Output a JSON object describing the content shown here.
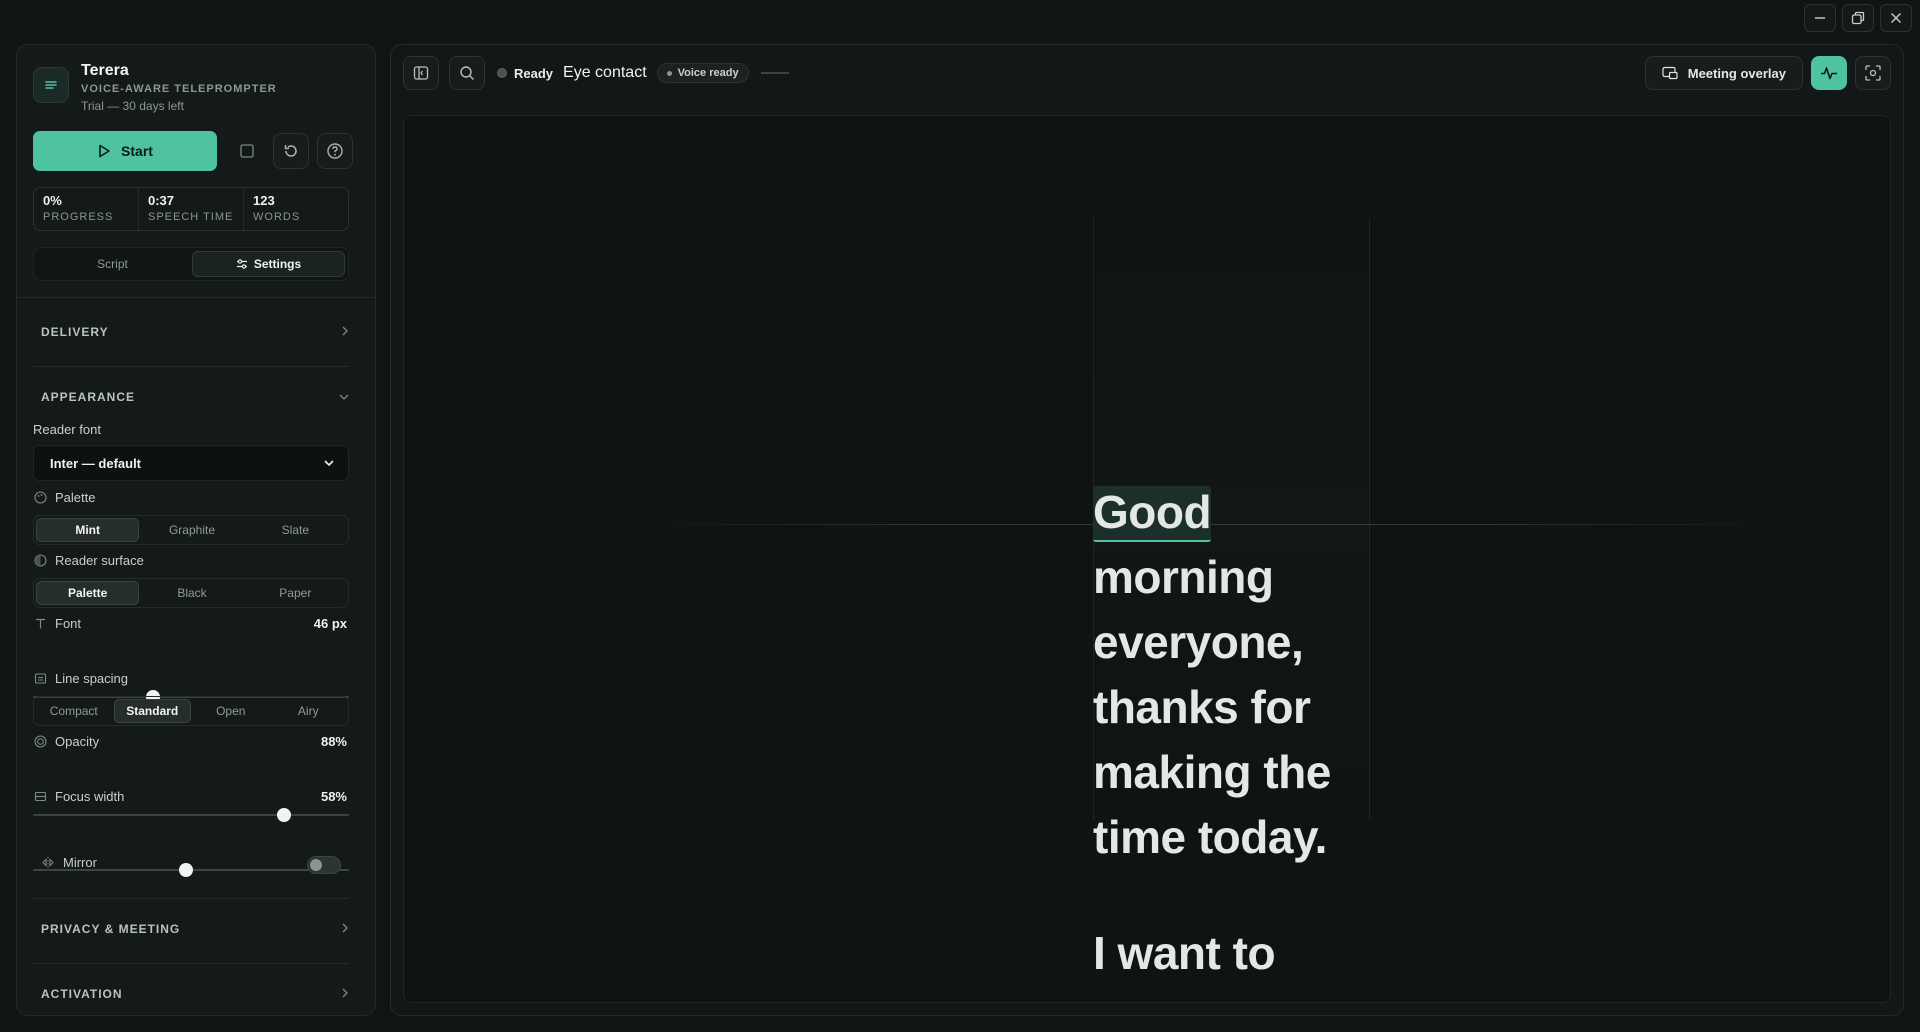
{
  "window": {
    "controls": [
      "minimize",
      "restore",
      "close"
    ]
  },
  "brand": {
    "title": "Terera",
    "subtitle": "VOICE-AWARE TELEPROMPTER",
    "trial": "Trial — 30 days left"
  },
  "controls": {
    "start_label": "Start"
  },
  "stats": [
    {
      "value": "0%",
      "label": "PROGRESS"
    },
    {
      "value": "0:37",
      "label": "SPEECH TIME"
    },
    {
      "value": "123",
      "label": "WORDS"
    }
  ],
  "tabs": {
    "script": "Script",
    "settings": "Settings",
    "active": "Settings"
  },
  "sections": {
    "delivery": "DELIVERY",
    "appearance": "APPEARANCE",
    "privacy": "PRIVACY & MEETING",
    "activation": "ACTIVATION"
  },
  "appearance": {
    "reader_font_label": "Reader font",
    "reader_font_value": "Inter — default",
    "palette_label": "Palette",
    "palette_options": [
      "Mint",
      "Graphite",
      "Slate"
    ],
    "palette_selected": "Mint",
    "surface_label": "Reader surface",
    "surface_options": [
      "Palette",
      "Black",
      "Paper"
    ],
    "surface_selected": "Palette",
    "font_label": "Font",
    "font_value": "46 px",
    "font_slider": 0.38,
    "line_spacing_label": "Line spacing",
    "line_spacing_options": [
      "Compact",
      "Standard",
      "Open",
      "Airy"
    ],
    "line_spacing_selected": "Standard",
    "opacity_label": "Opacity",
    "opacity_value": "88%",
    "opacity_slider": 0.795,
    "focus_width_label": "Focus width",
    "focus_width_value": "58%",
    "focus_width_slider": 0.485,
    "mirror_label": "Mirror",
    "mirror_on": false
  },
  "topbar": {
    "status": "Ready",
    "title": "Eye contact",
    "voice_status": "Voice ready",
    "overlay_button": "Meeting overlay"
  },
  "reader": {
    "current_word": "Good",
    "lines": [
      "morning",
      "everyone,",
      "thanks for",
      "making the",
      "time today."
    ],
    "next_line": "I want to"
  },
  "colors": {
    "accent": "#4fc3a1",
    "background": "#101514",
    "panel": "#131a19"
  }
}
